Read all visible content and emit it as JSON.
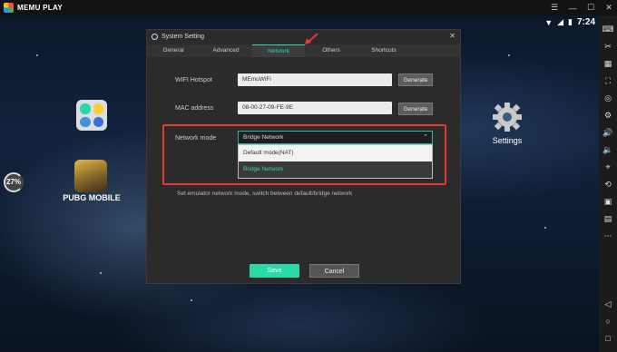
{
  "app": {
    "brand": "MEMU PLAY"
  },
  "window_controls": [
    "☰",
    "—",
    "☐",
    "✕"
  ],
  "status": {
    "time": "7:24"
  },
  "desktop": {
    "pubg_label": "PUBG MOBILE",
    "settings_label": "Settings",
    "gauge_value": "27%"
  },
  "dialog": {
    "title": "System Setting",
    "tabs": [
      "General",
      "Advanced",
      "Network",
      "Others",
      "Shortcuts"
    ],
    "active_tab": "Network",
    "wifi": {
      "label": "WIFI Hotspot",
      "value": "MEmuWiFi",
      "button": "Generate"
    },
    "mac": {
      "label": "MAC address",
      "value": "08-00-27-09-FE-9E",
      "button": "Generate"
    },
    "network_mode": {
      "label": "Network mode",
      "selected": "Bridge Network",
      "options": [
        "Default mode(NAT)",
        "Bridge Network"
      ]
    },
    "description": "Set emulator network mode, switch between default/bridge network",
    "save_label": "Save",
    "cancel_label": "Cancel"
  },
  "colors": {
    "accent": "#2bd8b6",
    "highlight": "#e53935",
    "save": "#2bd8a8"
  }
}
